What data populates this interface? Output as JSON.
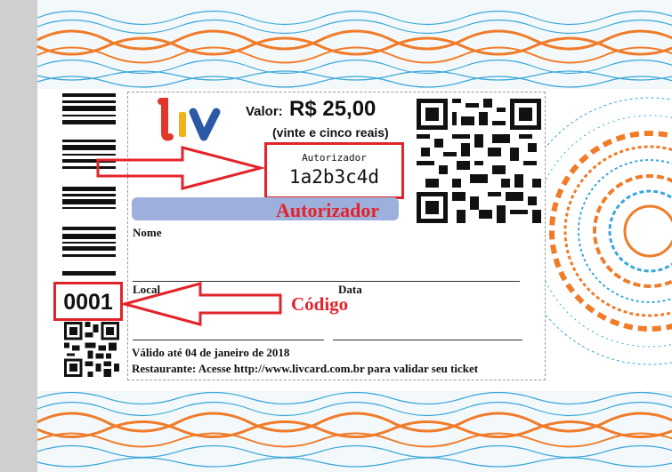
{
  "ticket": {
    "brand": "liv",
    "valor_label": "Valor:",
    "valor_value": "R$ 25,00",
    "valor_extenso": "(vinte e cinco reais)",
    "autorizador_label": "Autorizador",
    "autorizador_code": "1a2b3c4d",
    "autorizador_callout": "Autorizador",
    "nome_label": "Nome",
    "local_label": "Local",
    "data_label": "Data",
    "codigo_value": "0001",
    "codigo_callout": "Código",
    "validade_text": "Válido até 04 de janeiro de 2018",
    "restaurante_text": "Restaurante: Acesse http://www.livcard.com.br para validar seu ticket"
  },
  "colors": {
    "accent_red": "#e3232b",
    "guilloche_orange": "#f07c2a",
    "guilloche_blue": "#3aa7d9",
    "logo_l": "#e0372a",
    "logo_i": "#f2b21c",
    "logo_v": "#2c58a8",
    "auth_bar": "#9db0dc"
  },
  "icons": [
    "logo-liv",
    "qr-code-large",
    "qr-code-small",
    "barcode-vertical",
    "arrow-right-outline",
    "arrow-left-outline"
  ]
}
